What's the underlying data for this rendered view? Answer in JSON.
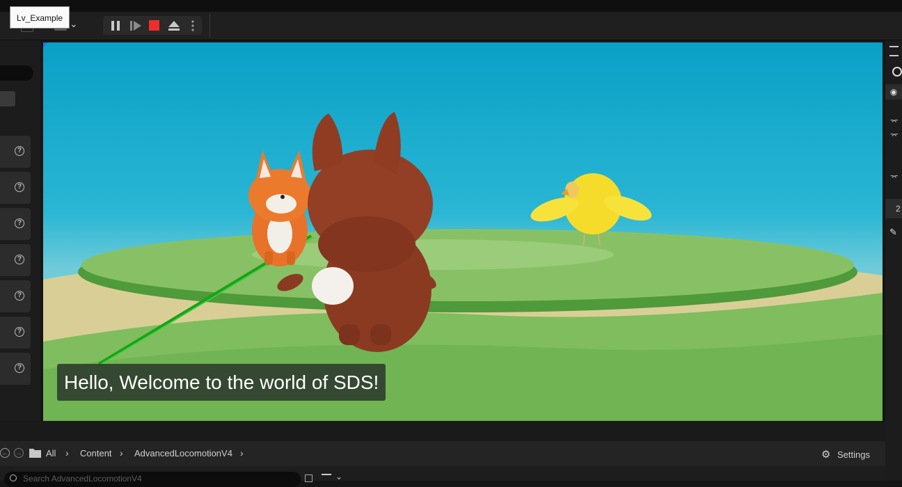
{
  "window": {
    "tooltip": "Lv_Example"
  },
  "toolbar": {
    "pause_icon": "pause-icon",
    "step_icon": "frame-skip-icon",
    "stop_icon": "stop-icon",
    "eject_icon": "eject-icon",
    "more_icon": "more-vertical-icon",
    "stop_color": "#ec2e2e"
  },
  "viewport": {
    "subtitle": "Hello, Welcome to the world of SDS!"
  },
  "content_browser": {
    "breadcrumbs": [
      "All",
      "Content",
      "AdvancedLocomotionV4"
    ],
    "settings_label": "Settings",
    "search_placeholder": "Search AdvancedLocomotionV4"
  },
  "right_panel": {
    "partial_value": "2"
  }
}
